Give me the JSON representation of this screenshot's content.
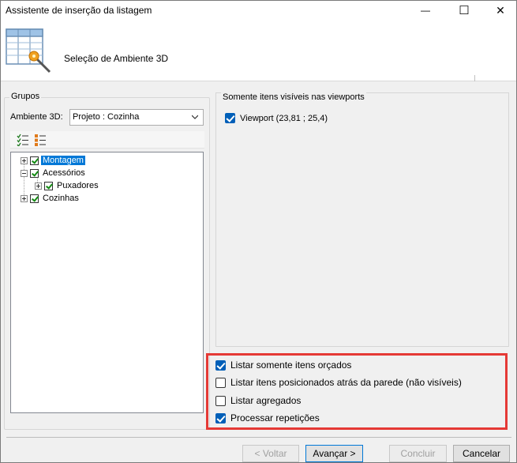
{
  "window": {
    "title": "Assistente de inserção da listagem",
    "minimize_glyph": "—",
    "maximize_glyph": "☐",
    "close_glyph": "✕"
  },
  "header": {
    "subtitle": "Seleção de Ambiente 3D",
    "icon": "list-wizard-icon"
  },
  "groups": {
    "label": "Grupos",
    "ambiente_label": "Ambiente 3D:",
    "ambiente_value": "Projeto : Cozinha",
    "toolbar_icons": [
      "check-all-icon",
      "uncheck-all-icon"
    ],
    "tree": [
      {
        "label": "Montagem",
        "checked": true,
        "selected": true,
        "expander": "plus"
      },
      {
        "label": "Acessórios",
        "checked": true,
        "selected": false,
        "expander": "minus"
      },
      {
        "label": "Puxadores",
        "checked": true,
        "selected": false,
        "expander": "plus"
      },
      {
        "label": "Cozinhas",
        "checked": true,
        "selected": false,
        "expander": "plus"
      }
    ]
  },
  "viewports": {
    "label": "Somente itens visíveis nas viewports",
    "items": [
      {
        "label": "Viewport (23,81 ; 25,4)",
        "checked": true
      }
    ]
  },
  "options": [
    {
      "label": "Listar somente itens orçados",
      "checked": true
    },
    {
      "label": "Listar itens posicionados atrás da parede (não visíveis)",
      "checked": false
    },
    {
      "label": "Listar agregados",
      "checked": false
    },
    {
      "label": "Processar repetições",
      "checked": true
    }
  ],
  "highlight_color": "#e53935",
  "accent_color": "#005fb8",
  "buttons": {
    "back": "< Voltar",
    "next": "Avançar >",
    "finish": "Concluir",
    "cancel": "Cancelar"
  }
}
